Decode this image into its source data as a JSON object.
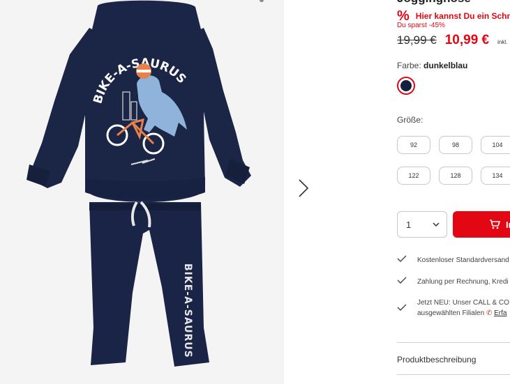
{
  "product": {
    "title": "Jogginghose",
    "color_hex": "#14213d"
  },
  "promo": {
    "icon": "percent-icon",
    "text": "Hier kannst Du ein Schnä",
    "saving": "Du sparst -45%"
  },
  "price": {
    "old": "19,99 €",
    "new": "10,99 €",
    "vat": "inkl."
  },
  "color": {
    "label": "Farbe:",
    "value": "dunkelblau"
  },
  "size": {
    "label": "Größe:",
    "options": [
      "92",
      "98",
      "104",
      "122",
      "128",
      "134"
    ]
  },
  "quantity": {
    "value": "1"
  },
  "cart": {
    "label": "In"
  },
  "benefits": [
    {
      "lines": [
        "Kostenloser Standardversand"
      ]
    },
    {
      "lines": [
        "Zahlung per Rechnung, Kredi"
      ]
    },
    {
      "lines": [
        "Jetzt NEU: Unser CALL & CO",
        "ausgewählten Filialen"
      ],
      "link": "Erfa"
    }
  ],
  "description": {
    "label": "Produktbeschreibung"
  },
  "artwork": {
    "front_print": "BIKE-A-SAURUS",
    "leg_print": "BIKE-A-SAURUS"
  },
  "colors": {
    "accent": "#e30613",
    "navy": "#14213d",
    "gallery_bg": "#f4f4f4"
  }
}
